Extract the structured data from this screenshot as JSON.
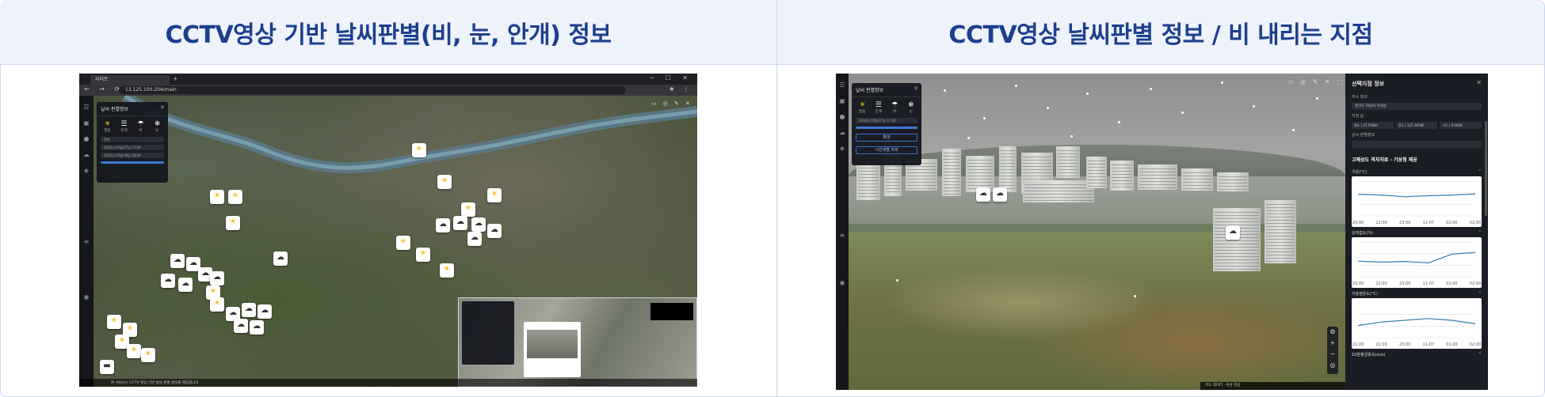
{
  "titles": {
    "left": "CCTV영상 기반 날씨판별(비, 눈, 안개) 정보",
    "right": "CCTV영상 날씨판별 정보 / 비 내리는 지점"
  },
  "browser": {
    "tab_label": "사이트",
    "url": "13.125.100.204/main",
    "window_controls": "─ ☐ ✕"
  },
  "weather_panel": {
    "title": "날씨 판별정보",
    "close": "✕",
    "types": [
      {
        "icon": "☀",
        "label": "맑음"
      },
      {
        "icon": "☰",
        "label": "안개"
      },
      {
        "icon": "☂",
        "label": "비"
      },
      {
        "icon": "❄",
        "label": "눈"
      }
    ],
    "select_value": "전체",
    "date_fields": [
      "2024년 05월 07일 17:00",
      "2024년 05월 08일 18:00"
    ],
    "buttons": [
      "확대",
      "시간대별 조회"
    ]
  },
  "info_panel": {
    "title": "선택지점 정보",
    "close": "✕",
    "address_label": "주소 정보",
    "address_value": "경기도 하남시 미사동",
    "coord_label": "지점 값",
    "coords": [
      "위도 | 37.55883",
      "경도 | 127.18780",
      "고도 | 0.0000"
    ],
    "weather_label": "날씨 판별정보",
    "forecast_title": "고해상도 격자자료 - 기상청 제공",
    "charts": [
      {
        "label": "기온(°C)",
        "x": [
          "20:00",
          "22:00",
          "23:00",
          "11-07",
          "01:00",
          "02:00"
        ],
        "values": [
          0.62,
          0.6,
          0.55,
          0.58,
          0.6,
          0.63
        ]
      },
      {
        "label": "상대습도(%)",
        "x": [
          "20:00",
          "22:00",
          "23:00",
          "11-07",
          "01:00",
          "02:00"
        ],
        "values": [
          0.45,
          0.42,
          0.44,
          0.4,
          0.65,
          0.7
        ]
      },
      {
        "label": "이슬점온도(°C)",
        "x": [
          "21:00",
          "22:00",
          "23:00",
          "11-07",
          "01:00",
          "02:00"
        ],
        "values": [
          0.35,
          0.45,
          0.5,
          0.55,
          0.5,
          0.4
        ]
      }
    ],
    "bottom_label": "10분평균풍속(m/s)"
  },
  "footer_left": "본 서비스는 CCTV 영상 기반 날씨 판별 정보를 제공합니다",
  "footer_right": "지도 데이터 · 위성 영상"
}
